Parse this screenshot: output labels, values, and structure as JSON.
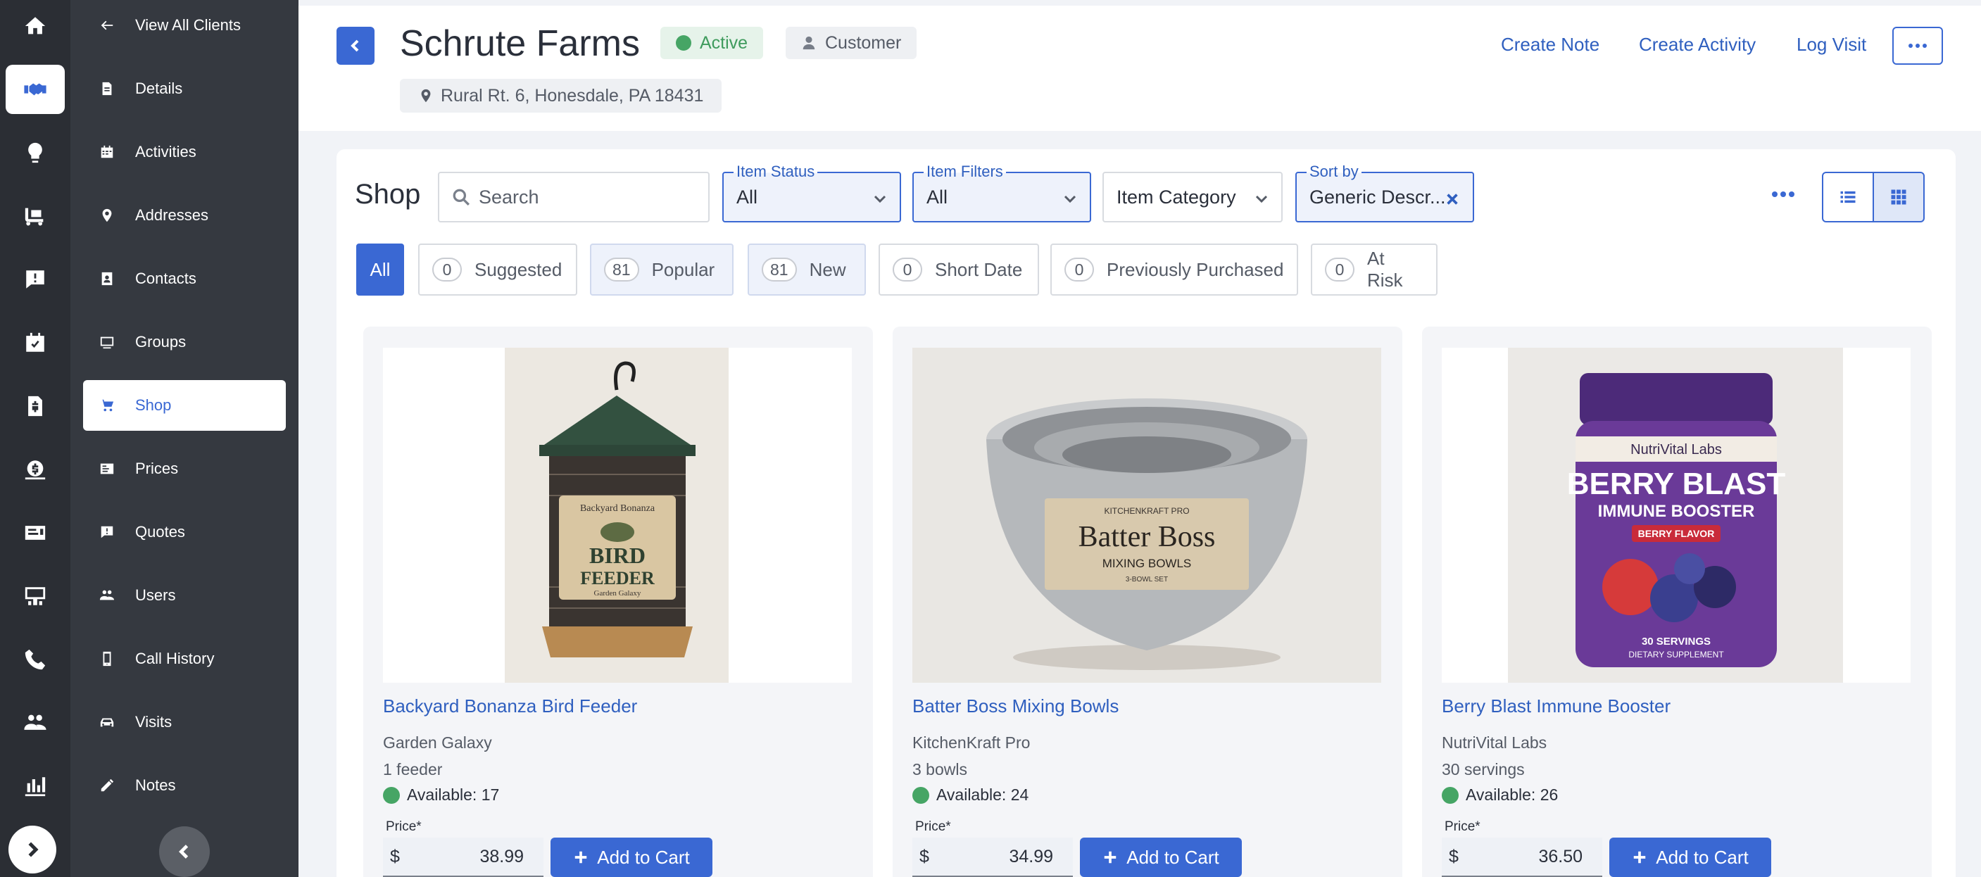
{
  "rail": {
    "icons": [
      "home-icon",
      "handshake-icon",
      "lightbulb-icon",
      "truck-icon",
      "alert-chat-icon",
      "calendar-check-icon",
      "invoice-icon",
      "money-bag-icon",
      "id-card-icon",
      "presentation-icon",
      "phone-icon",
      "people-icon",
      "chart-icon"
    ],
    "active": "handshake-icon"
  },
  "sidebar": {
    "back_label": "View All Clients",
    "items": [
      {
        "label": "Details",
        "icon": "document-icon"
      },
      {
        "label": "Activities",
        "icon": "calendar-icon"
      },
      {
        "label": "Addresses",
        "icon": "map-pin-icon"
      },
      {
        "label": "Contacts",
        "icon": "contact-card-icon"
      },
      {
        "label": "Groups",
        "icon": "groups-icon"
      },
      {
        "label": "Shop",
        "icon": "cart-icon",
        "active": true
      },
      {
        "label": "Prices",
        "icon": "price-list-icon"
      },
      {
        "label": "Quotes",
        "icon": "quote-icon"
      },
      {
        "label": "Users",
        "icon": "users-icon"
      },
      {
        "label": "Call History",
        "icon": "mobile-icon"
      },
      {
        "label": "Visits",
        "icon": "car-icon"
      },
      {
        "label": "Notes",
        "icon": "pencil-icon"
      }
    ]
  },
  "header": {
    "client_name": "Schrute Farms",
    "status": "Active",
    "type": "Customer",
    "address": "Rural Rt. 6, Honesdale, PA 18431",
    "actions": [
      "Create Note",
      "Create Activity",
      "Log Visit"
    ]
  },
  "shop": {
    "title": "Shop",
    "search_placeholder": "Search",
    "item_status": {
      "legend": "Item Status",
      "value": "All"
    },
    "item_filters": {
      "legend": "Item Filters",
      "value": "All"
    },
    "item_category": {
      "placeholder": "Item Category"
    },
    "sort_by": {
      "legend": "Sort by",
      "value": "Generic Descr..."
    },
    "chips": [
      {
        "label": "All",
        "count": null
      },
      {
        "label": "Suggested",
        "count": "0"
      },
      {
        "label": "Popular",
        "count": "81"
      },
      {
        "label": "New",
        "count": "81"
      },
      {
        "label": "Short Date",
        "count": "0"
      },
      {
        "label": "Previously Purchased",
        "count": "0"
      },
      {
        "label": "At Risk",
        "count": "0"
      }
    ]
  },
  "products": [
    {
      "name": "Backyard Bonanza Bird Feeder",
      "brand": "Garden Galaxy",
      "pack": "1 feeder",
      "available_label": "Available:",
      "available": "17",
      "price_label": "Price*",
      "currency": "$",
      "price": "38.99",
      "cta": "Add to Cart",
      "image_text": {
        "brand": "Backyard Bonanza",
        "line1": "BIRD",
        "line2": "FEEDER",
        "sub": "Garden Galaxy"
      }
    },
    {
      "name": "Batter Boss Mixing Bowls",
      "brand": "KitchenKraft Pro",
      "pack": "3 bowls",
      "available_label": "Available:",
      "available": "24",
      "price_label": "Price*",
      "currency": "$",
      "price": "34.99",
      "cta": "Add to Cart",
      "image_text": {
        "brand": "KITCHENKRAFT PRO",
        "line1": "Batter Boss",
        "line2": "MIXING BOWLS",
        "sub": "3-BOWL SET"
      }
    },
    {
      "name": "Berry Blast Immune Booster",
      "brand": "NutriVital Labs",
      "pack": "30 servings",
      "available_label": "Available:",
      "available": "26",
      "price_label": "Price*",
      "currency": "$",
      "price": "36.50",
      "cta": "Add to Cart",
      "image_text": {
        "brand": "NutriVital Labs",
        "line1": "BERRY BLAST",
        "line2": "IMMUNE BOOSTER",
        "flavor": "BERRY FLAVOR",
        "sub": "30 SERVINGS",
        "sub2": "DIETARY SUPPLEMENT"
      }
    }
  ],
  "colors": {
    "accent": "#3a68d3",
    "rail_bg": "#2b2e34",
    "sidebar_bg": "#353940",
    "success": "#46a565"
  }
}
